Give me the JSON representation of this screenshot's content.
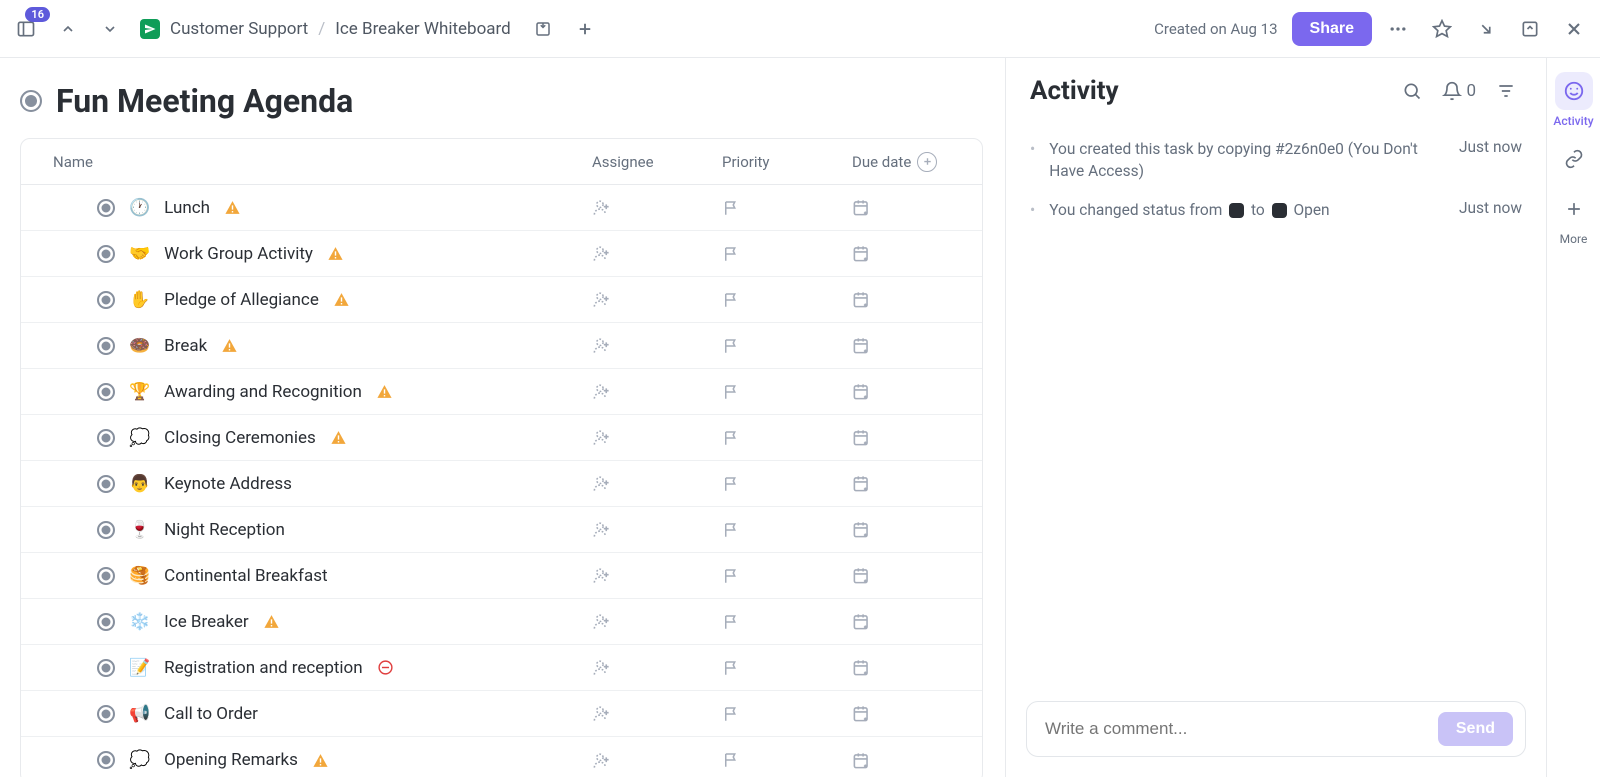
{
  "topbar": {
    "badge_count": "16",
    "breadcrumb": {
      "parent": "Customer Support",
      "current": "Ice Breaker Whiteboard"
    },
    "created_on": "Created on Aug 13",
    "share_label": "Share"
  },
  "task": {
    "title": "Fun Meeting Agenda"
  },
  "columns": {
    "name": "Name",
    "assignee": "Assignee",
    "priority": "Priority",
    "due": "Due date"
  },
  "subtasks": [
    {
      "emoji": "🕐",
      "name": "Lunch",
      "flag": "warn"
    },
    {
      "emoji": "🤝",
      "name": "Work Group Activity",
      "flag": "warn"
    },
    {
      "emoji": "✋",
      "name": "Pledge of Allegiance",
      "flag": "warn"
    },
    {
      "emoji": "🍩",
      "name": "Break",
      "flag": "warn"
    },
    {
      "emoji": "🏆",
      "name": "Awarding and Recognition",
      "flag": "warn"
    },
    {
      "emoji": "💭",
      "name": "Closing Ceremonies",
      "flag": "warn"
    },
    {
      "emoji": "👨",
      "name": "Keynote Address",
      "flag": "none"
    },
    {
      "emoji": "🍷",
      "name": "Night Reception",
      "flag": "none"
    },
    {
      "emoji": "🥞",
      "name": "Continental Breakfast",
      "flag": "none"
    },
    {
      "emoji": "❄️",
      "name": "Ice Breaker",
      "flag": "warn"
    },
    {
      "emoji": "📝",
      "name": "Registration and reception",
      "flag": "nopri"
    },
    {
      "emoji": "📢",
      "name": "Call to Order",
      "flag": "none"
    },
    {
      "emoji": "💭",
      "name": "Opening Remarks",
      "flag": "warn"
    }
  ],
  "activity": {
    "title": "Activity",
    "notif_count": "0",
    "items": [
      {
        "text_pre": "You created this task by copying ",
        "ref": "#2z6n0e0",
        "text_post": " (You Don't Have Access)",
        "time": "Just now"
      },
      {
        "text_pre": "You changed status from ",
        "status_change_to": "Open",
        "time": "Just now"
      }
    ],
    "comment_placeholder": "Write a comment...",
    "send_label": "Send"
  },
  "rail": {
    "activity": "Activity",
    "more": "More"
  }
}
